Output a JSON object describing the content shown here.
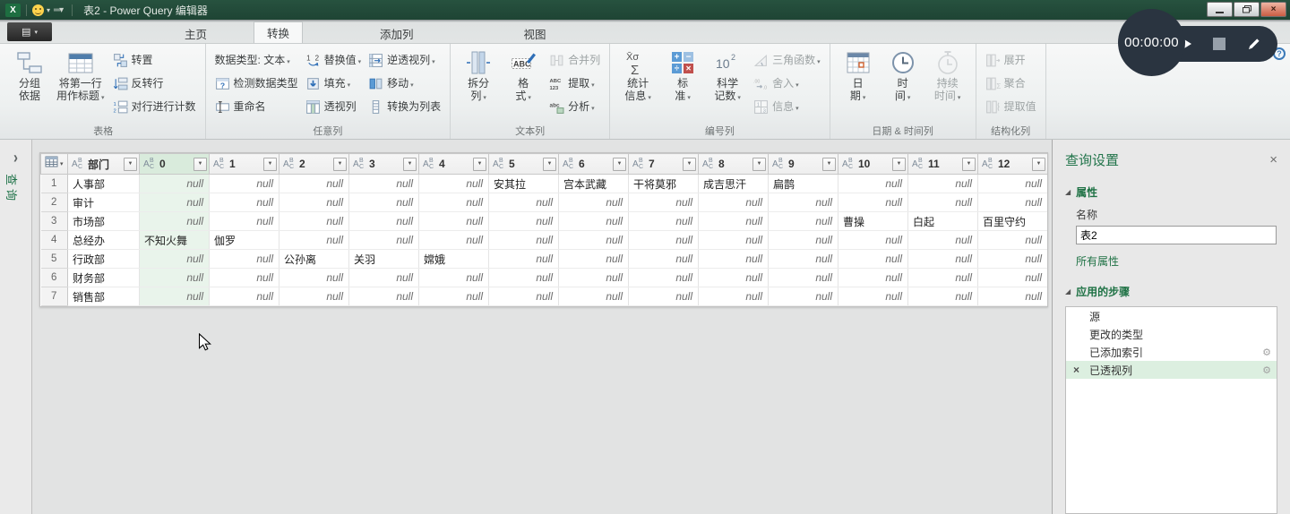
{
  "titlebar": {
    "title": "表2 - Power Query 编辑器"
  },
  "tabs": {
    "active": "转换",
    "items": [
      "主页",
      "转换",
      "添加列",
      "视图"
    ]
  },
  "ribbon": {
    "groups": [
      {
        "label": "表格",
        "items": [
          {
            "t": "large",
            "label": "分组\n依据",
            "icon": "group-by",
            "name": "group-by-button"
          },
          {
            "t": "large",
            "label": "将第一行\n用作标题",
            "icon": "first-row-header",
            "arrow": true,
            "name": "use-first-row-as-headers-button"
          },
          {
            "t": "stack",
            "items": [
              {
                "label": "转置",
                "icon": "transpose",
                "name": "transpose-button"
              },
              {
                "label": "反转行",
                "icon": "reverse-rows",
                "name": "reverse-rows-button"
              },
              {
                "label": "对行进行计数",
                "icon": "count-rows",
                "name": "count-rows-button"
              }
            ]
          }
        ]
      },
      {
        "label": "任意列",
        "items": [
          {
            "t": "stack",
            "items": [
              {
                "label": "数据类型: 文本",
                "arrow": true,
                "name": "data-type-button"
              },
              {
                "label": "检测数据类型",
                "icon": "detect-type",
                "name": "detect-data-type-button"
              },
              {
                "label": "重命名",
                "icon": "rename",
                "name": "rename-button"
              }
            ]
          },
          {
            "t": "stack",
            "items": [
              {
                "label": "替换值",
                "icon": "replace-values",
                "arrow": true,
                "name": "replace-values-button"
              },
              {
                "label": "填充",
                "icon": "fill-down",
                "arrow": true,
                "name": "fill-button"
              },
              {
                "label": "透视列",
                "icon": "pivot",
                "name": "pivot-column-button"
              }
            ]
          },
          {
            "t": "stack",
            "items": [
              {
                "label": "逆透视列",
                "icon": "unpivot",
                "arrow": true,
                "name": "unpivot-columns-button"
              },
              {
                "label": "移动",
                "icon": "move",
                "arrow": true,
                "name": "move-button"
              },
              {
                "label": "转换为列表",
                "icon": "to-list",
                "name": "convert-to-list-button"
              }
            ]
          }
        ]
      },
      {
        "label": "文本列",
        "items": [
          {
            "t": "large",
            "label": "拆分\n列",
            "icon": "split-column",
            "arrow": true,
            "name": "split-column-button"
          },
          {
            "t": "large",
            "label": "格\n式",
            "icon": "format-abc",
            "arrow": true,
            "name": "format-button"
          },
          {
            "t": "stack",
            "items": [
              {
                "label": "合并列",
                "icon": "merge-columns",
                "disabled": true,
                "name": "merge-columns-button"
              },
              {
                "label": "提取",
                "icon": "extract",
                "arrow": true,
                "name": "extract-button"
              },
              {
                "label": "分析",
                "icon": "parse",
                "arrow": true,
                "name": "parse-button"
              }
            ]
          }
        ]
      },
      {
        "label": "编号列",
        "items": [
          {
            "t": "large",
            "label": "统计\n信息",
            "icon": "statistics",
            "arrow": true,
            "name": "statistics-button"
          },
          {
            "t": "large",
            "label": "标\n准",
            "icon": "standard-ops",
            "arrow": true,
            "name": "standard-button"
          },
          {
            "t": "large",
            "label": "科学\n记数",
            "icon": "scientific",
            "arrow": true,
            "name": "scientific-notation-button"
          },
          {
            "t": "stack",
            "items": [
              {
                "label": "三角函数",
                "icon": "trig",
                "arrow": true,
                "disabled": true,
                "name": "trigonometry-button"
              },
              {
                "label": "舍入",
                "icon": "round",
                "arrow": true,
                "disabled": true,
                "name": "rounding-button"
              },
              {
                "label": "信息",
                "icon": "info",
                "arrow": true,
                "disabled": true,
                "name": "information-button"
              }
            ]
          }
        ]
      },
      {
        "label": "日期 & 时间列",
        "items": [
          {
            "t": "large",
            "label": "日\n期",
            "icon": "date",
            "arrow": true,
            "name": "date-button"
          },
          {
            "t": "large",
            "label": "时\n间",
            "icon": "time",
            "arrow": true,
            "name": "time-button"
          },
          {
            "t": "large",
            "label": "持续\n时间",
            "icon": "duration",
            "arrow": true,
            "disabled": true,
            "name": "duration-button"
          }
        ]
      },
      {
        "label": "结构化列",
        "items": [
          {
            "t": "stack",
            "items": [
              {
                "label": "展开",
                "icon": "expand",
                "disabled": true,
                "name": "expand-button"
              },
              {
                "label": "聚合",
                "icon": "aggregate",
                "disabled": true,
                "name": "aggregate-button"
              },
              {
                "label": "提取值",
                "icon": "extract-values",
                "disabled": true,
                "name": "extract-values-button"
              }
            ]
          }
        ]
      }
    ]
  },
  "recorder": {
    "time": "00:00:00"
  },
  "sidebar": {
    "label": "查询"
  },
  "table": {
    "selected_column": "0",
    "columns": [
      "部门",
      "0",
      "1",
      "2",
      "3",
      "4",
      "5",
      "6",
      "7",
      "8",
      "9",
      "10",
      "11",
      "12"
    ],
    "rows": [
      {
        "num": "1",
        "cells": [
          "人事部",
          "null",
          "null",
          "null",
          "null",
          "null",
          "安其拉",
          "宫本武藏",
          "干将莫邪",
          "成吉思汗",
          "扁鹊",
          "null",
          "null",
          "null"
        ]
      },
      {
        "num": "2",
        "cells": [
          "审计",
          "null",
          "null",
          "null",
          "null",
          "null",
          "null",
          "null",
          "null",
          "null",
          "null",
          "null",
          "null",
          "null"
        ]
      },
      {
        "num": "3",
        "cells": [
          "市场部",
          "null",
          "null",
          "null",
          "null",
          "null",
          "null",
          "null",
          "null",
          "null",
          "null",
          "曹操",
          "白起",
          "百里守约"
        ]
      },
      {
        "num": "4",
        "cells": [
          "总经办",
          "不知火舞",
          "伽罗",
          "null",
          "null",
          "null",
          "null",
          "null",
          "null",
          "null",
          "null",
          "null",
          "null",
          "null"
        ]
      },
      {
        "num": "5",
        "cells": [
          "行政部",
          "null",
          "null",
          "公孙离",
          "关羽",
          "嫦娥",
          "null",
          "null",
          "null",
          "null",
          "null",
          "null",
          "null",
          "null"
        ]
      },
      {
        "num": "6",
        "cells": [
          "财务部",
          "null",
          "null",
          "null",
          "null",
          "null",
          "null",
          "null",
          "null",
          "null",
          "null",
          "null",
          "null",
          "null"
        ]
      },
      {
        "num": "7",
        "cells": [
          "销售部",
          "null",
          "null",
          "null",
          "null",
          "null",
          "null",
          "null",
          "null",
          "null",
          "null",
          "null",
          "null",
          "null"
        ]
      }
    ]
  },
  "panel": {
    "title": "查询设置",
    "properties_label": "属性",
    "name_label": "名称",
    "name_value": "表2",
    "all_properties": "所有属性",
    "steps_label": "应用的步骤",
    "steps": [
      {
        "label": "源"
      },
      {
        "label": "更改的类型"
      },
      {
        "label": "已添加索引",
        "gear": true
      },
      {
        "label": "已透视列",
        "gear": true,
        "removable": true,
        "selected": true
      }
    ]
  }
}
